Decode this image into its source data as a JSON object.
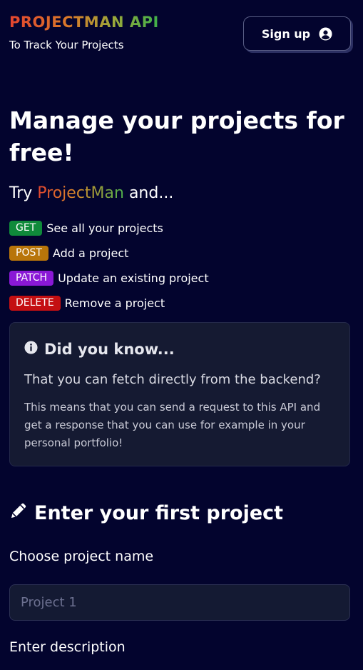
{
  "header": {
    "brand": "PROJECTMAN API",
    "tagline": "To Track Your Projects",
    "signup_label": "Sign up",
    "signup_icon": "user-circle-icon"
  },
  "hero": {
    "title": "Manage your projects for free!",
    "try_prefix": "Try ",
    "try_brand": "ProjectMan",
    "try_suffix": " and..."
  },
  "methods": [
    {
      "badge": "GET",
      "color": "#0f8a3a",
      "desc": "See all your projects"
    },
    {
      "badge": "POST",
      "color": "#b8750a",
      "desc": "Add a project"
    },
    {
      "badge": "PATCH",
      "color": "#8a18d6",
      "desc": "Update an existing project"
    },
    {
      "badge": "DELETE",
      "color": "#c40f12",
      "desc": "Remove a project"
    }
  ],
  "info_card": {
    "icon": "info-circle-icon",
    "title": "Did you know...",
    "question": "That you can fetch directly from the backend?",
    "body": "This means that you can send a request to this API and get a response that you can use for example in your personal portfolio!"
  },
  "form": {
    "icon": "pencil-icon",
    "title": "Enter your first project",
    "name_label": "Choose project name",
    "name_placeholder": "Project 1",
    "name_value": "",
    "description_label": "Enter description"
  },
  "colors": {
    "background": "#03042e",
    "card": "#151a32",
    "brand_start": "#e2442f",
    "brand_end": "#3fb04a"
  }
}
